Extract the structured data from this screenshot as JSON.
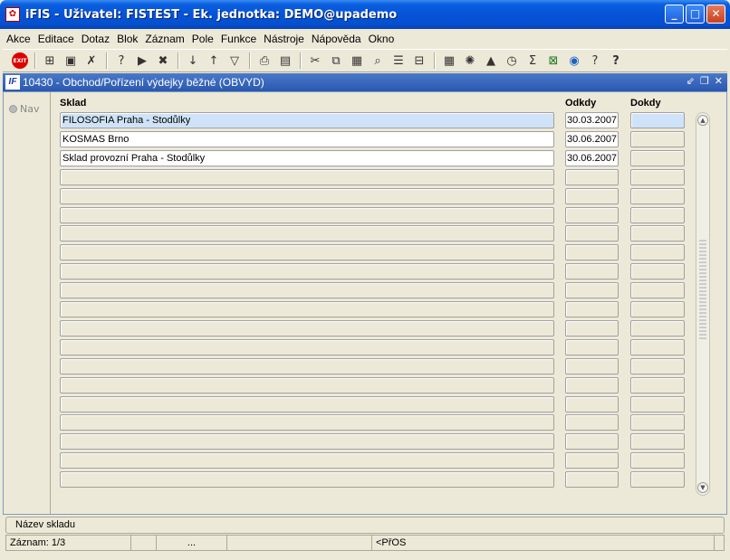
{
  "window": {
    "title": "iFIS - Uživatel: FISTEST - Ek. jednotka: DEMO@upademo",
    "icon": "ifis-app-icon",
    "controls": [
      "minimize",
      "maximize",
      "close"
    ]
  },
  "menu": [
    "Akce",
    "Editace",
    "Dotaz",
    "Blok",
    "Záznam",
    "Pole",
    "Funkce",
    "Nástroje",
    "Nápověda",
    "Okno"
  ],
  "toolbar": {
    "exit_label": "EXIT",
    "icons": [
      "insert-record-icon",
      "save-icon",
      "delete-record-icon",
      "query-icon",
      "execute-query-icon",
      "cancel-query-icon",
      "sort-asc-icon",
      "sort-desc-icon",
      "filter-icon",
      "print-icon",
      "print-preview-icon",
      "cut-icon",
      "copy-icon",
      "paste-icon",
      "find-icon",
      "list-icon",
      "tree-icon",
      "calculator-icon",
      "settings-icon",
      "chart-icon",
      "clock-icon",
      "sum-icon",
      "excel-icon",
      "internet-icon",
      "help-icon",
      "context-help-icon"
    ]
  },
  "form": {
    "icon_label": "IF",
    "title": "10430 - Obchod/Pořízení výdejky běžné (OBVYD)",
    "nav_label": "Nav",
    "columns": {
      "sklad": "Sklad",
      "odkdy": "Odkdy",
      "dokdy": "Dokdy"
    },
    "rows": [
      {
        "sklad": "FILOSOFIA Praha - Stodůlky",
        "odkdy": "30.03.2007",
        "dokdy": ""
      },
      {
        "sklad": "KOSMAS Brno",
        "odkdy": "30.06.2007",
        "dokdy": ""
      },
      {
        "sklad": "Sklad provozní Praha - Stodůlky",
        "odkdy": "30.06.2007",
        "dokdy": ""
      },
      {
        "sklad": "",
        "odkdy": "",
        "dokdy": ""
      },
      {
        "sklad": "",
        "odkdy": "",
        "dokdy": ""
      },
      {
        "sklad": "",
        "odkdy": "",
        "dokdy": ""
      },
      {
        "sklad": "",
        "odkdy": "",
        "dokdy": ""
      },
      {
        "sklad": "",
        "odkdy": "",
        "dokdy": ""
      },
      {
        "sklad": "",
        "odkdy": "",
        "dokdy": ""
      },
      {
        "sklad": "",
        "odkdy": "",
        "dokdy": ""
      },
      {
        "sklad": "",
        "odkdy": "",
        "dokdy": ""
      },
      {
        "sklad": "",
        "odkdy": "",
        "dokdy": ""
      },
      {
        "sklad": "",
        "odkdy": "",
        "dokdy": ""
      },
      {
        "sklad": "",
        "odkdy": "",
        "dokdy": ""
      },
      {
        "sklad": "",
        "odkdy": "",
        "dokdy": ""
      },
      {
        "sklad": "",
        "odkdy": "",
        "dokdy": ""
      },
      {
        "sklad": "",
        "odkdy": "",
        "dokdy": ""
      },
      {
        "sklad": "",
        "odkdy": "",
        "dokdy": ""
      },
      {
        "sklad": "",
        "odkdy": "",
        "dokdy": ""
      },
      {
        "sklad": "",
        "odkdy": "",
        "dokdy": ""
      }
    ]
  },
  "status": {
    "hint": "Název skladu",
    "record": "Záznam: 1/3",
    "ellipsis": "...",
    "mode": "<PřOS"
  }
}
